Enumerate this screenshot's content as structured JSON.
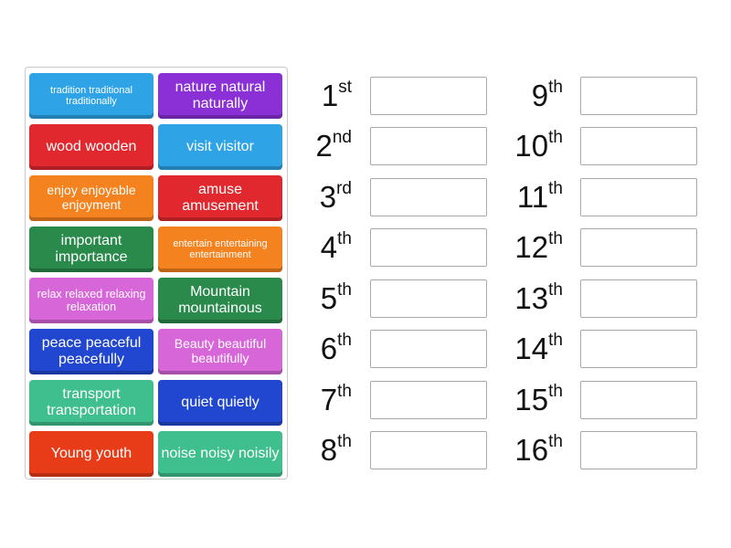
{
  "tiles": [
    {
      "text": "tradition traditional traditionally",
      "color": "#2ea3e6"
    },
    {
      "text": "nature natural naturally",
      "color": "#8b2fd6"
    },
    {
      "text": "wood wooden",
      "color": "#e0282e"
    },
    {
      "text": "visit visitor",
      "color": "#2ea3e6"
    },
    {
      "text": "enjoy enjoyable enjoyment",
      "color": "#f4821f"
    },
    {
      "text": "amuse amusement",
      "color": "#e0282e"
    },
    {
      "text": "important importance",
      "color": "#2a8a4c"
    },
    {
      "text": "entertain entertaining entertainment",
      "color": "#f4821f"
    },
    {
      "text": "relax relaxed relaxing relaxation",
      "color": "#d766d9"
    },
    {
      "text": "Mountain mountainous",
      "color": "#2a8a4c"
    },
    {
      "text": "peace peaceful peacefully",
      "color": "#2146cf"
    },
    {
      "text": "Beauty beautiful beautifully",
      "color": "#d766d9"
    },
    {
      "text": "transport transportation",
      "color": "#3fbf8e"
    },
    {
      "text": "quiet quietly",
      "color": "#2146cf"
    },
    {
      "text": "Young youth",
      "color": "#e83b17"
    },
    {
      "text": "noise noisy noisily",
      "color": "#3fbf8e"
    }
  ],
  "slots": [
    {
      "num": "1",
      "suffix": "st"
    },
    {
      "num": "2",
      "suffix": "nd"
    },
    {
      "num": "3",
      "suffix": "rd"
    },
    {
      "num": "4",
      "suffix": "th"
    },
    {
      "num": "5",
      "suffix": "th"
    },
    {
      "num": "6",
      "suffix": "th"
    },
    {
      "num": "7",
      "suffix": "th"
    },
    {
      "num": "8",
      "suffix": "th"
    },
    {
      "num": "9",
      "suffix": "th"
    },
    {
      "num": "10",
      "suffix": "th"
    },
    {
      "num": "11",
      "suffix": "th"
    },
    {
      "num": "12",
      "suffix": "th"
    },
    {
      "num": "13",
      "suffix": "th"
    },
    {
      "num": "14",
      "suffix": "th"
    },
    {
      "num": "15",
      "suffix": "th"
    },
    {
      "num": "16",
      "suffix": "th"
    }
  ]
}
